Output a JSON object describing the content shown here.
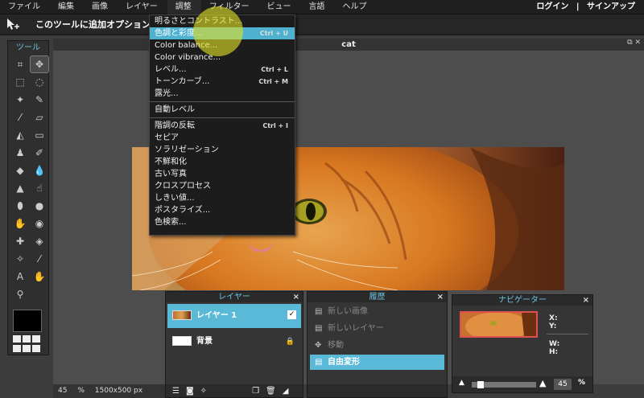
{
  "menubar": {
    "items": [
      "ファイル",
      "編集",
      "画像",
      "レイヤー",
      "調整",
      "フィルター",
      "ビュー",
      "言語",
      "ヘルプ"
    ],
    "login": "ログイン",
    "divider": "|",
    "signup": "サインアップ"
  },
  "optionbar": {
    "text": "このツールに追加オプションは"
  },
  "tools": {
    "title": "ツール",
    "icons": [
      "crop-icon",
      "move-icon",
      "marquee-icon",
      "lasso-icon",
      "magic-wand-icon",
      "pencil-icon",
      "brush-icon",
      "eraser-icon",
      "bucket-icon",
      "gradient-icon",
      "stamp-icon",
      "color-replace-icon",
      "drawing-icon",
      "blur-icon",
      "sharpen-icon",
      "smudge-icon",
      "sponge-icon",
      "dodge-icon",
      "burn-icon",
      "redeye-icon",
      "spot-heal-icon",
      "bloat-icon",
      "pinch-icon",
      "color-picker-icon",
      "type-icon",
      "hand-icon",
      "zoom-icon"
    ]
  },
  "document": {
    "title": "cat",
    "status_zoom": "45",
    "status_pct": "%",
    "status_size": "1500x500 px"
  },
  "adjust_menu": {
    "group1": [
      {
        "label": "明るさとコントラスト...",
        "shortcut": ""
      },
      {
        "label": "色調と彩度...",
        "shortcut": "Ctrl + U",
        "highlight": true
      },
      {
        "label": "Color balance...",
        "shortcut": ""
      },
      {
        "label": "Color vibrance...",
        "shortcut": ""
      },
      {
        "label": "レベル...",
        "shortcut": "Ctrl + L"
      },
      {
        "label": "トーンカーブ...",
        "shortcut": "Ctrl + M"
      },
      {
        "label": "露光...",
        "shortcut": ""
      }
    ],
    "group2": [
      {
        "label": "自動レベル",
        "shortcut": ""
      }
    ],
    "group3": [
      {
        "label": "階調の反転",
        "shortcut": "Ctrl + I"
      },
      {
        "label": "セピア",
        "shortcut": ""
      },
      {
        "label": "ソラリゼーション",
        "shortcut": ""
      },
      {
        "label": "不鮮和化",
        "shortcut": ""
      },
      {
        "label": "古い写真",
        "shortcut": ""
      },
      {
        "label": "クロスプロセス",
        "shortcut": ""
      },
      {
        "label": "しきい値...",
        "shortcut": ""
      },
      {
        "label": "ポスタライズ...",
        "shortcut": ""
      },
      {
        "label": "色検索...",
        "shortcut": ""
      }
    ]
  },
  "layers": {
    "title": "レイヤー",
    "close": "×",
    "items": [
      {
        "name": "レイヤー 1",
        "selected": true,
        "check": "✓"
      },
      {
        "name": "背景",
        "selected": false,
        "lock": "🔒"
      }
    ]
  },
  "history": {
    "title": "履歴",
    "close": "×",
    "items": [
      {
        "label": "新しい画像",
        "active": false
      },
      {
        "label": "新しいレイヤー",
        "active": false
      },
      {
        "label": "移動",
        "active": false
      },
      {
        "label": "自由変形",
        "active": true
      }
    ]
  },
  "navigator": {
    "title": "ナビゲーター",
    "close": "×",
    "x_label": "X:",
    "y_label": "Y:",
    "w_label": "W:",
    "h_label": "H:",
    "zoom": "45",
    "zoom_pct": "%",
    "zoom_fraction": 0.1
  },
  "colors": {
    "accent": "#5bb9d8",
    "title": "#6cc3e0",
    "menubar": "#1f1f1f"
  }
}
